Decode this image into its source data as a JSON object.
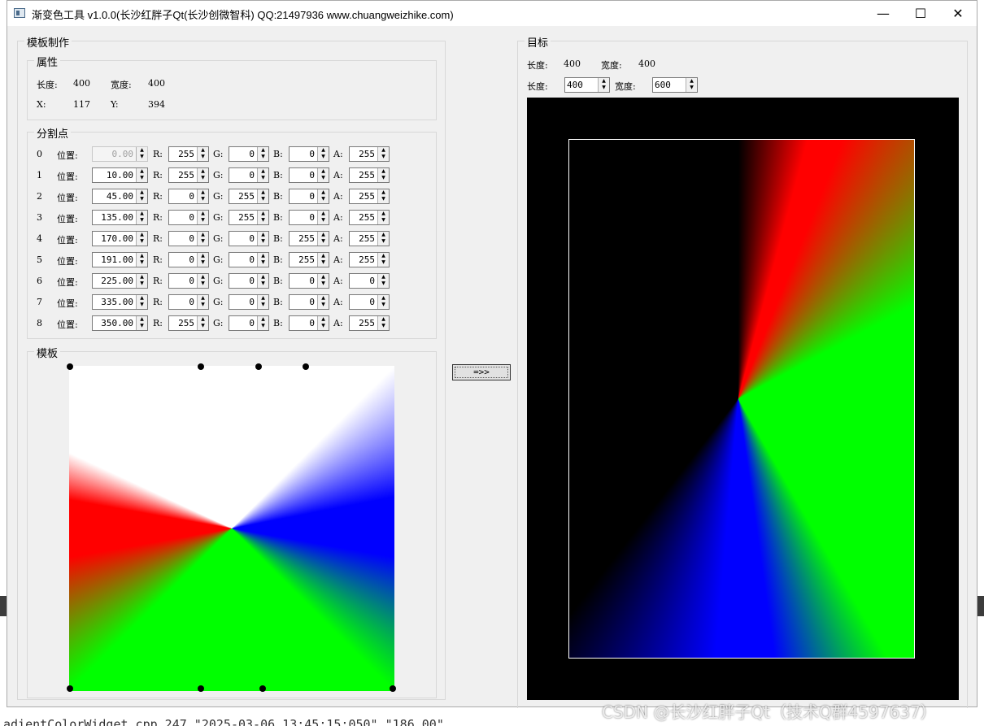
{
  "window": {
    "title": "渐变色工具 v1.0.0(长沙红胖子Qt(长沙创微智科) QQ:21497936 www.chuangweizhike.com)",
    "min_glyph": "—",
    "max_glyph": "☐",
    "close_glyph": "✕"
  },
  "template_group": {
    "title": "模板制作",
    "properties": {
      "title": "属性",
      "length_label": "长度:",
      "length_value": "400",
      "width_label": "宽度:",
      "width_value": "400",
      "x_label": "X:",
      "x_value": "117",
      "y_label": "Y:",
      "y_value": "394"
    },
    "split_points": {
      "title": "分割点",
      "pos_label": "位置:",
      "r_label": "R:",
      "g_label": "G:",
      "b_label": "B:",
      "a_label": "A:",
      "rows": [
        {
          "idx": "0",
          "pos": "0.00",
          "r": "255",
          "g": "0",
          "b": "0",
          "a": "255"
        },
        {
          "idx": "1",
          "pos": "10.00",
          "r": "255",
          "g": "0",
          "b": "0",
          "a": "255"
        },
        {
          "idx": "2",
          "pos": "45.00",
          "r": "0",
          "g": "255",
          "b": "0",
          "a": "255"
        },
        {
          "idx": "3",
          "pos": "135.00",
          "r": "0",
          "g": "255",
          "b": "0",
          "a": "255"
        },
        {
          "idx": "4",
          "pos": "170.00",
          "r": "0",
          "g": "0",
          "b": "255",
          "a": "255"
        },
        {
          "idx": "5",
          "pos": "191.00",
          "r": "0",
          "g": "0",
          "b": "255",
          "a": "255"
        },
        {
          "idx": "6",
          "pos": "225.00",
          "r": "0",
          "g": "0",
          "b": "0",
          "a": "0"
        },
        {
          "idx": "7",
          "pos": "335.00",
          "r": "0",
          "g": "0",
          "b": "0",
          "a": "0"
        },
        {
          "idx": "8",
          "pos": "350.00",
          "r": "255",
          "g": "0",
          "b": "0",
          "a": "255"
        }
      ]
    },
    "template": {
      "title": "模板"
    }
  },
  "convert_button": "=>>",
  "target_group": {
    "title": "目标",
    "length_label": "长度:",
    "length_value": "400",
    "width_label": "宽度:",
    "width_value": "400",
    "length_input_label": "长度:",
    "length_input": "400",
    "width_input_label": "宽度:",
    "width_input": "600"
  },
  "background": {
    "bottom_text": "adientColorWidget.cpp 247 \"2025-03-06 13:45:15:050\" \"186.00\""
  },
  "watermark": "CSDN @长沙红胖子Qt（技术Q群4597637）"
}
